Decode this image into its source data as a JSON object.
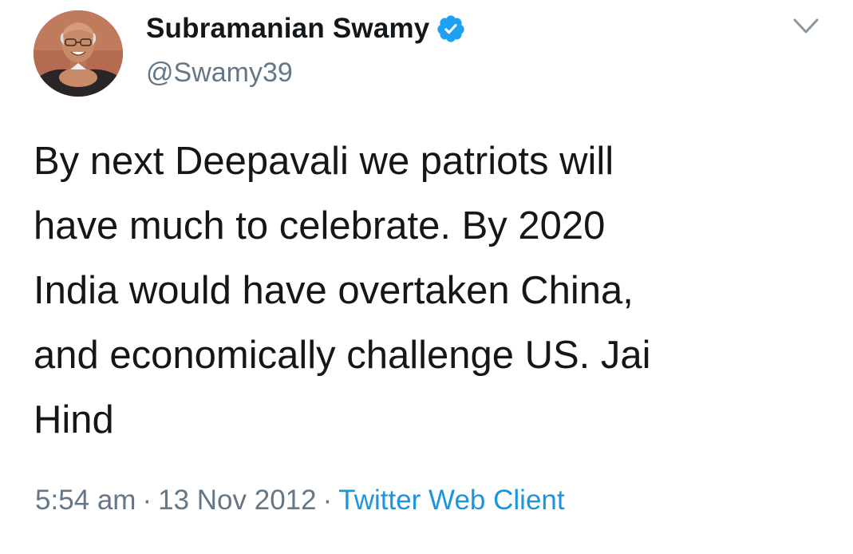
{
  "author": {
    "display_name": "Subramanian Swamy",
    "handle": "@Swamy39",
    "verified": true,
    "avatar_icon": "profile-photo"
  },
  "tweet": {
    "text": "By next Deepavali we patriots will\nhave much to celebrate. By 2020\nIndia would have overtaken China,\nand economically challenge US. Jai\nHind"
  },
  "meta": {
    "time": "5:54 am",
    "separator": "·",
    "date": "13 Nov 2012",
    "source": "Twitter Web Client"
  },
  "icons": {
    "verified": "verified-badge-icon",
    "menu": "chevron-down-icon"
  },
  "colors": {
    "text": "#14171a",
    "secondary": "#657786",
    "link": "#1b95e0",
    "verified": "#1da1f2"
  }
}
